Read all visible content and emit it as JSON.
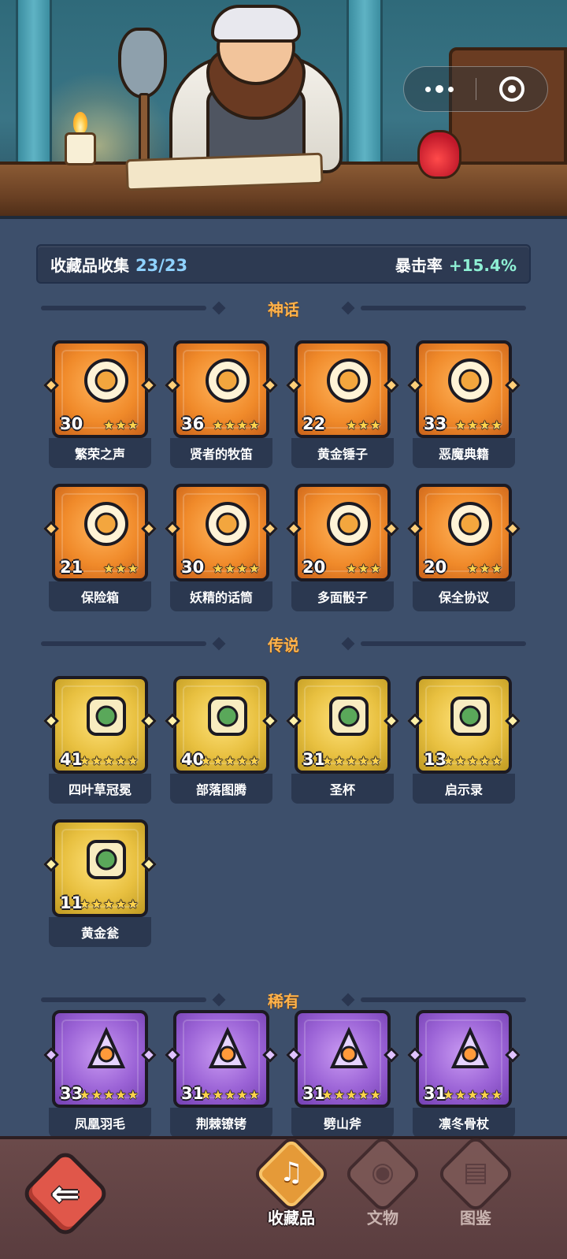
{
  "summary": {
    "label": "收藏品收集",
    "count": "23/23",
    "crit_label": "暴击率",
    "crit_value": "+15.4%"
  },
  "sections": {
    "mythic": "神话",
    "legend": "传说",
    "rare": "稀有"
  },
  "items": {
    "mythic": [
      {
        "name": "繁荣之声",
        "level": "30",
        "stars": 3,
        "icon": "blue-orb-icon"
      },
      {
        "name": "贤者的牧笛",
        "level": "36",
        "stars": 4,
        "icon": "feather-flute-icon"
      },
      {
        "name": "黄金锤子",
        "level": "22",
        "stars": 3,
        "icon": "golden-hammer-icon"
      },
      {
        "name": "恶魔典籍",
        "level": "33",
        "stars": 4,
        "icon": "demon-book-icon"
      },
      {
        "name": "保险箱",
        "level": "21",
        "stars": 3,
        "icon": "treasure-chest-icon"
      },
      {
        "name": "妖精的话筒",
        "level": "30",
        "stars": 4,
        "icon": "fairy-microphone-icon"
      },
      {
        "name": "多面骰子",
        "level": "20",
        "stars": 3,
        "icon": "polyhedral-dice-icon"
      },
      {
        "name": "保全协议",
        "level": "20",
        "stars": 3,
        "icon": "contract-scroll-icon"
      }
    ],
    "legend": [
      {
        "name": "四叶草冠冕",
        "level": "41",
        "stars": 5,
        "icon": "clover-crown-icon"
      },
      {
        "name": "部落图腾",
        "level": "40",
        "stars": 5,
        "icon": "tribal-totem-icon"
      },
      {
        "name": "圣杯",
        "level": "31",
        "stars": 5,
        "icon": "holy-grail-icon"
      },
      {
        "name": "启示录",
        "level": "13",
        "stars": 5,
        "icon": "revelation-book-icon"
      },
      {
        "name": "黄金瓮",
        "level": "11",
        "stars": 5,
        "icon": "golden-urn-icon"
      }
    ],
    "rare": [
      {
        "name": "凤凰羽毛",
        "level": "33",
        "stars": 5,
        "icon": "phoenix-feather-icon"
      },
      {
        "name": "荆棘镣铐",
        "level": "31",
        "stars": 5,
        "icon": "thorn-shackles-icon"
      },
      {
        "name": "劈山斧",
        "level": "31",
        "stars": 5,
        "icon": "mountain-axe-icon"
      },
      {
        "name": "凛冬骨杖",
        "level": "31",
        "stars": 5,
        "icon": "winter-bone-staff-icon"
      }
    ]
  },
  "nav": {
    "back_icon": "back-arrow-icon",
    "tabs": [
      {
        "label": "收藏品",
        "active": true,
        "icon": "harp-icon"
      },
      {
        "label": "文物",
        "active": false,
        "icon": "eye-icon"
      },
      {
        "label": "图鉴",
        "active": false,
        "icon": "book-icon"
      }
    ]
  },
  "colors": {
    "mythic": "#f08a2a",
    "legend": "#e8c040",
    "rare": "#9b63d6",
    "section_title": "#ffb24a",
    "background": "#3d4f6b"
  }
}
